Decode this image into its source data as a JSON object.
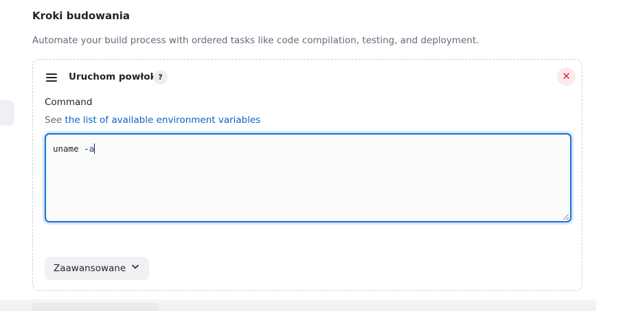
{
  "section": {
    "title": "Kroki budowania",
    "description": "Automate your build process with ordered tasks like code compilation, testing, and deployment."
  },
  "step": {
    "title": "Uruchom powłokę",
    "help_label": "?",
    "close_label": "✕",
    "field_label": "Command",
    "env_prefix": "See ",
    "env_link": "the list of available environment variables",
    "command_plain": "uname -",
    "command_highlight": "a",
    "advanced_label": "Zaawansowane"
  },
  "icons": {
    "drag": "drag-handle-icon",
    "help": "question-icon",
    "close": "close-icon",
    "chevron": "chevron-down-icon"
  },
  "colors": {
    "accent": "#1b6fd4",
    "link": "#0b63c5",
    "danger": "#d9283d"
  }
}
